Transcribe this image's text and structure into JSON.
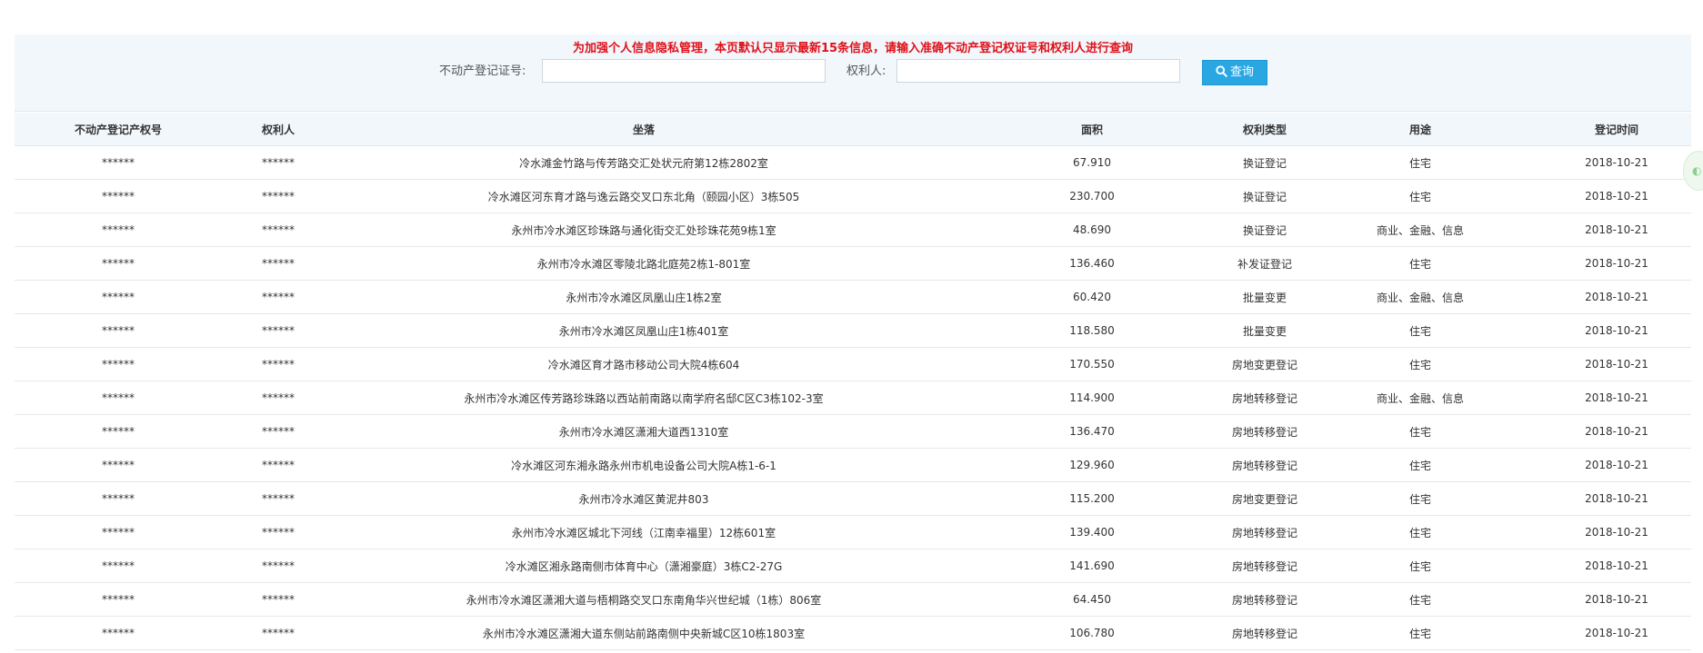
{
  "notice": "为加强个人信息隐私管理，本页默认只显示最新15条信息，请输入准确不动产登记权证号和权利人进行查询",
  "search": {
    "cert_label": "不动产登记证号:",
    "cert_value": "",
    "cert_placeholder": "",
    "owner_label": "权利人:",
    "owner_value": "",
    "owner_placeholder": "",
    "query_label": "查询",
    "query_icon": "search-icon"
  },
  "table": {
    "headers": [
      "不动产登记产权号",
      "权利人",
      "坐落",
      "面积",
      "权利类型",
      "用途",
      "登记时间"
    ],
    "rows": [
      [
        "******",
        "******",
        "冷水滩金竹路与传芳路交汇处状元府第12栋2802室",
        "67.910",
        "换证登记",
        "住宅",
        "2018-10-21"
      ],
      [
        "******",
        "******",
        "冷水滩区河东育才路与逸云路交叉口东北角（颐园小区）3栋505",
        "230.700",
        "换证登记",
        "住宅",
        "2018-10-21"
      ],
      [
        "******",
        "******",
        "永州市冷水滩区珍珠路与通化街交汇处珍珠花苑9栋1室",
        "48.690",
        "换证登记",
        "商业、金融、信息",
        "2018-10-21"
      ],
      [
        "******",
        "******",
        "永州市冷水滩区零陵北路北庭苑2栋1-801室",
        "136.460",
        "补发证登记",
        "住宅",
        "2018-10-21"
      ],
      [
        "******",
        "******",
        "永州市冷水滩区凤凰山庄1栋2室",
        "60.420",
        "批量变更",
        "商业、金融、信息",
        "2018-10-21"
      ],
      [
        "******",
        "******",
        "永州市冷水滩区凤凰山庄1栋401室",
        "118.580",
        "批量变更",
        "住宅",
        "2018-10-21"
      ],
      [
        "******",
        "******",
        "冷水滩区育才路市移动公司大院4栋604",
        "170.550",
        "房地变更登记",
        "住宅",
        "2018-10-21"
      ],
      [
        "******",
        "******",
        "永州市冷水滩区传芳路珍珠路以西站前南路以南学府名邸C区C3栋102-3室",
        "114.900",
        "房地转移登记",
        "商业、金融、信息",
        "2018-10-21"
      ],
      [
        "******",
        "******",
        "永州市冷水滩区潇湘大道西1310室",
        "136.470",
        "房地转移登记",
        "住宅",
        "2018-10-21"
      ],
      [
        "******",
        "******",
        "冷水滩区河东湘永路永州市机电设备公司大院A栋1-6-1",
        "129.960",
        "房地转移登记",
        "住宅",
        "2018-10-21"
      ],
      [
        "******",
        "******",
        "永州市冷水滩区黄泥井803",
        "115.200",
        "房地变更登记",
        "住宅",
        "2018-10-21"
      ],
      [
        "******",
        "******",
        "永州市冷水滩区城北下河线（江南幸福里）12栋601室",
        "139.400",
        "房地转移登记",
        "住宅",
        "2018-10-21"
      ],
      [
        "******",
        "******",
        "冷水滩区湘永路南侧市体育中心（潇湘豪庭）3栋C2-27G",
        "141.690",
        "房地转移登记",
        "住宅",
        "2018-10-21"
      ],
      [
        "******",
        "******",
        "永州市冷水滩区潇湘大道与梧桐路交叉口东南角华兴世纪城（1栋）806室",
        "64.450",
        "房地转移登记",
        "住宅",
        "2018-10-21"
      ],
      [
        "******",
        "******",
        "永州市冷水滩区潇湘大道东侧站前路南侧中央新城C区10栋1803室",
        "106.780",
        "房地转移登记",
        "住宅",
        "2018-10-21"
      ]
    ]
  },
  "colors": {
    "notice": "#e0101a",
    "button": "#2aa7e3",
    "panel_bg": "#f1f7fb"
  }
}
